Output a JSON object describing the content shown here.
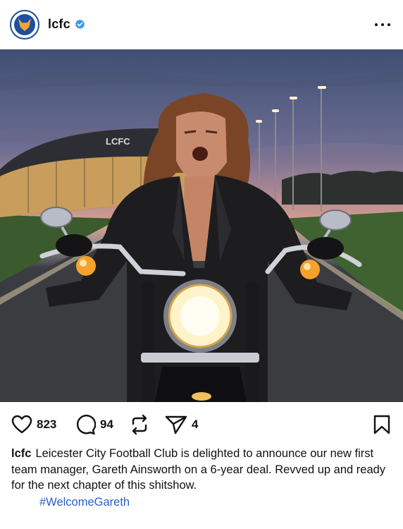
{
  "header": {
    "username": "lcfc",
    "verified_icon": "verified-badge-icon",
    "more_icon": "more-options-icon",
    "avatar_icon": "club-crest-icon"
  },
  "photo": {
    "building_sign": "LCFC",
    "description_icon": "post-photo"
  },
  "actions": {
    "like_count": "823",
    "comment_count": "94",
    "repost_icon": "repost-icon",
    "share_count": "4",
    "bookmark_icon": "bookmark-icon"
  },
  "caption": {
    "username": "lcfc",
    "text": "Leicester City Football Club is delighted to announce our new first team manager, Gareth Ainsworth on a 6-year deal. Revved up and ready for the next chapter of this shitshow.",
    "hashtag": "#WelcomeGareth"
  },
  "colors": {
    "accent": "#2a5fc9",
    "verified": "#3897f0",
    "club_blue": "#1e4fa0"
  }
}
